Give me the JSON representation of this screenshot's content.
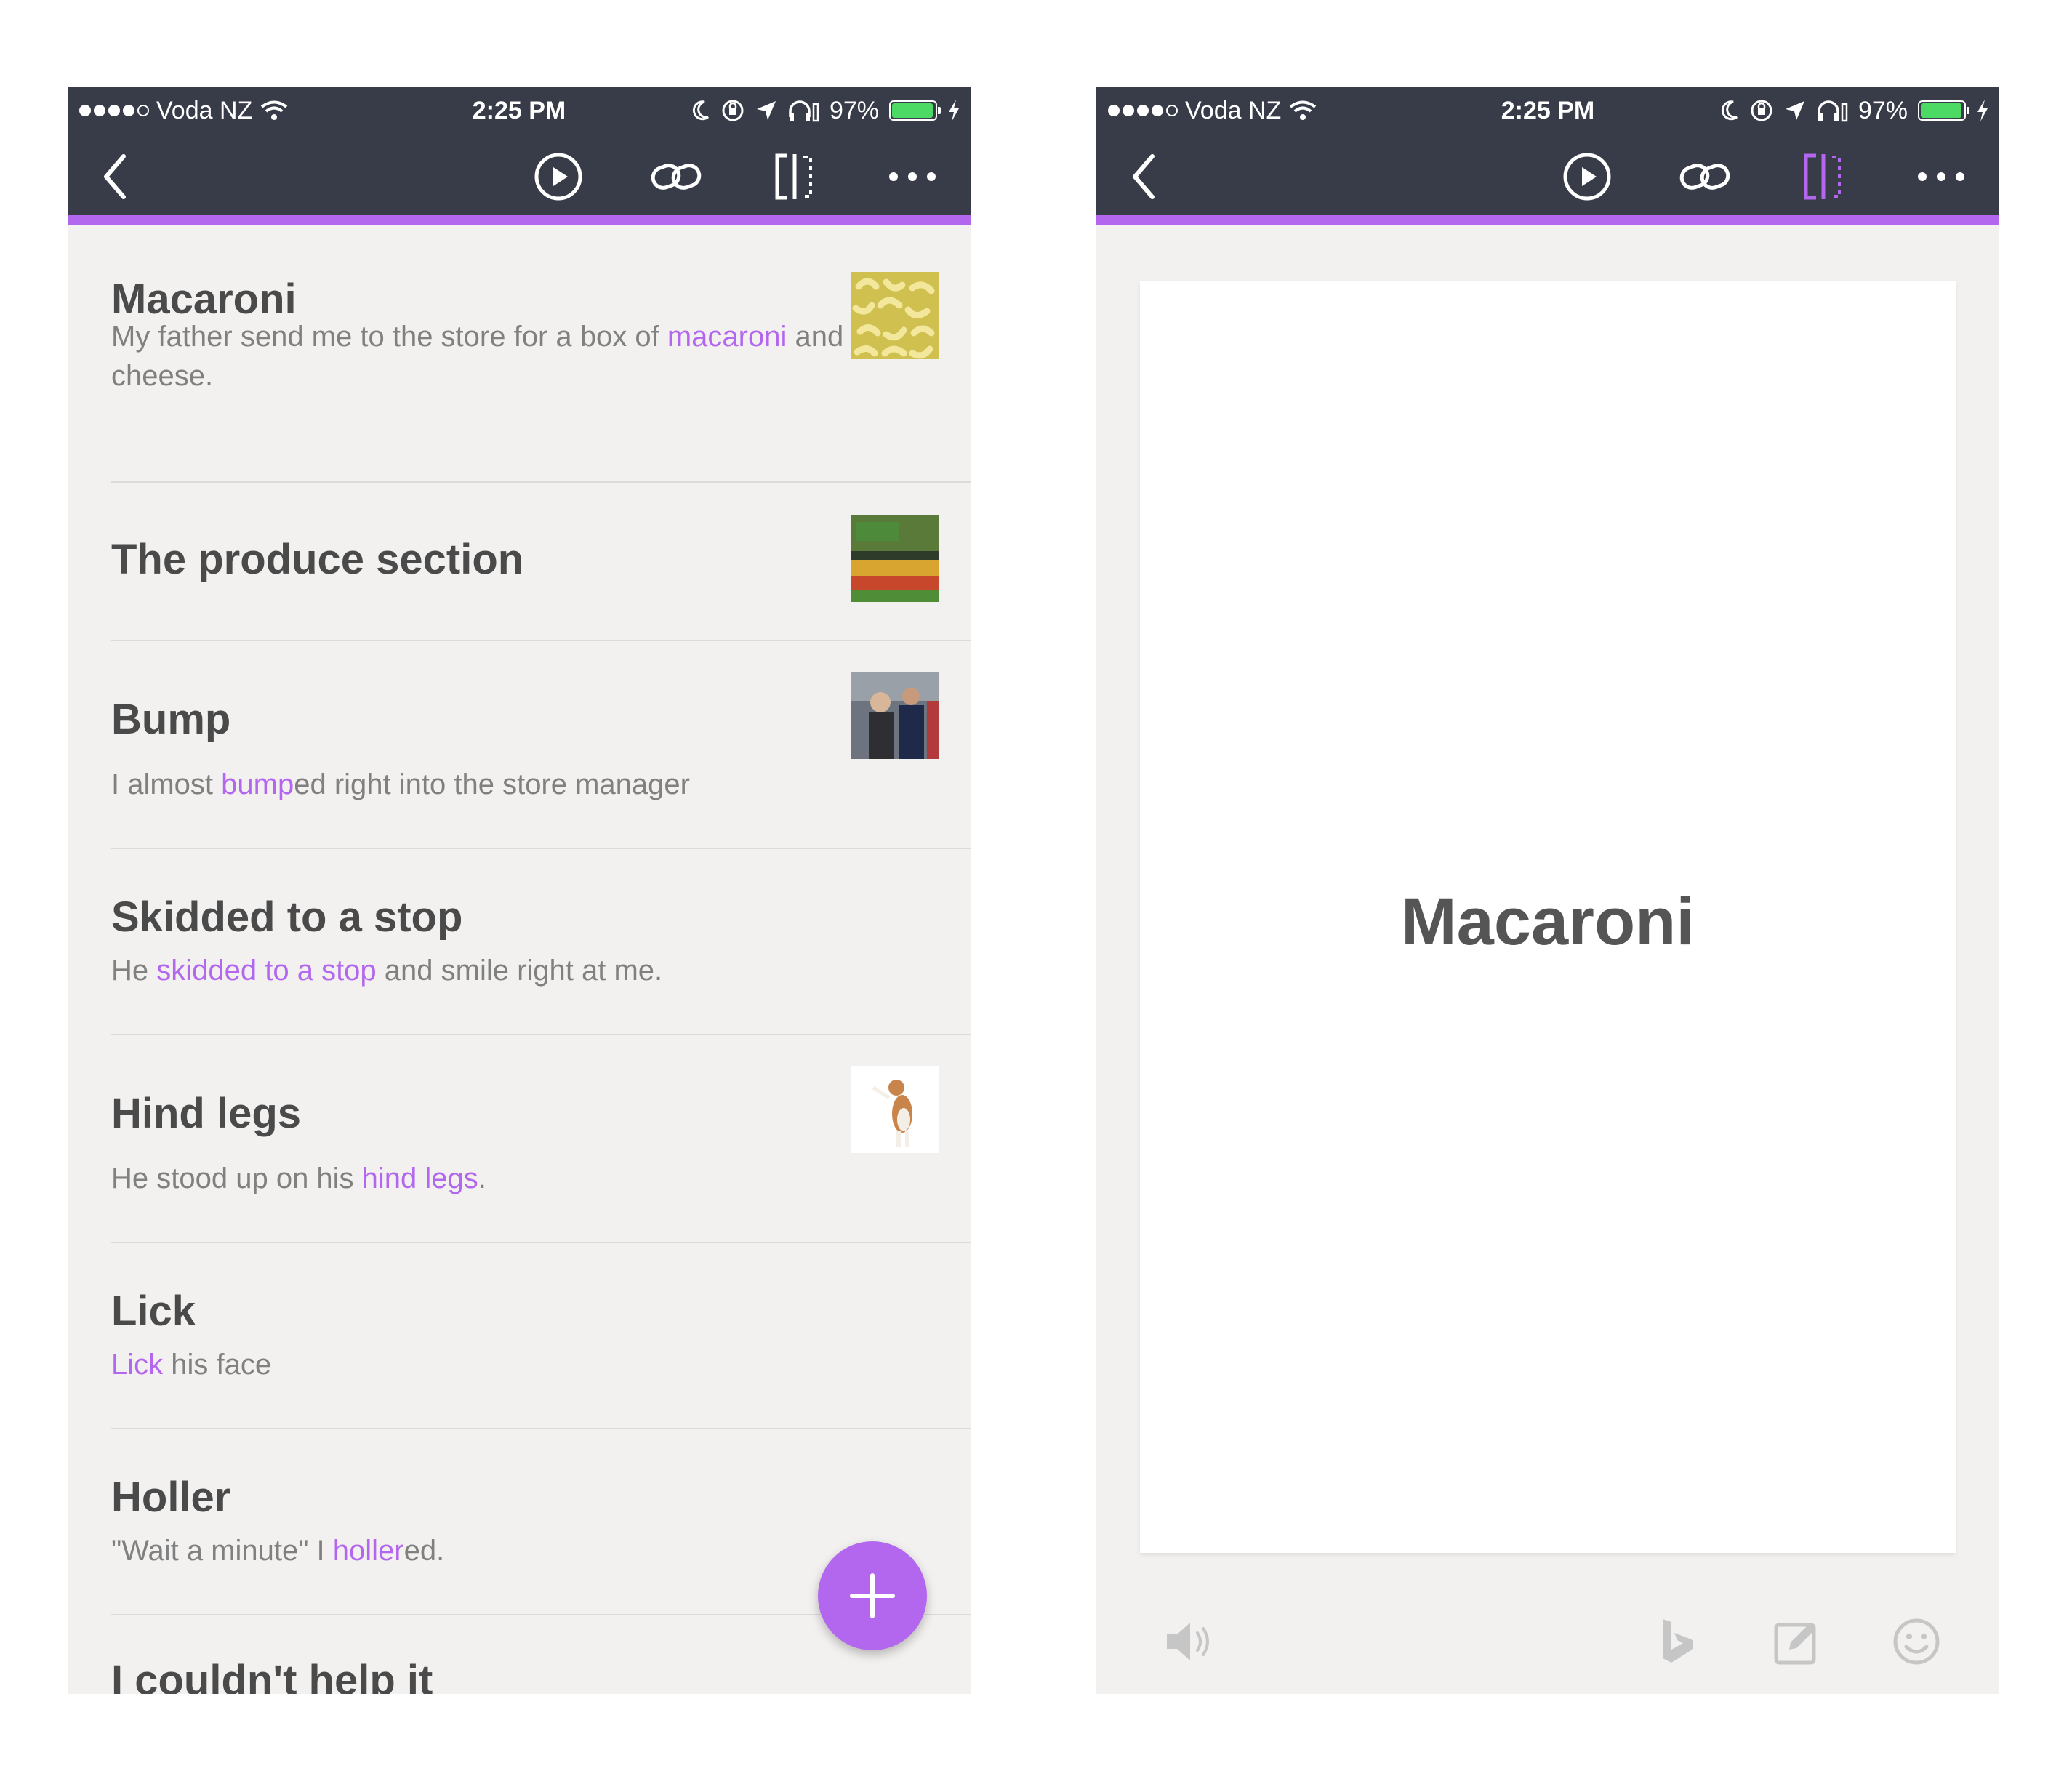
{
  "status_bar": {
    "carrier": "Voda NZ",
    "time": "2:25 PM",
    "battery": "97%",
    "battery_level": 0.97,
    "battery_color": "#4cd964"
  },
  "toolbar": {
    "icons": [
      "back-chevron-icon",
      "play-icon",
      "link-icon",
      "split-view-icon",
      "more-icon"
    ],
    "active_color": "#b366ee"
  },
  "colors": {
    "accent": "#b366ee",
    "bar": "#383c48"
  },
  "list_items": [
    {
      "title": "Macaroni",
      "sub": [
        {
          "t": "My father send me to the store for a box of "
        },
        {
          "t": "macaroni",
          "hl": true
        },
        {
          "t": " and cheese."
        }
      ],
      "thumb": "macaroni-image"
    },
    {
      "title": "The produce section",
      "sub": [],
      "thumb": "produce-image"
    },
    {
      "title": "Bump",
      "sub": [
        {
          "t": "I almost "
        },
        {
          "t": "bump",
          "hl": true
        },
        {
          "t": "ed right into the store manager"
        }
      ],
      "thumb": "bump-image"
    },
    {
      "title": "Skidded to a stop",
      "sub": [
        {
          "t": "He "
        },
        {
          "t": "skidded to a stop",
          "hl": true
        },
        {
          "t": " and smile right at me."
        }
      ]
    },
    {
      "title": "Hind legs",
      "sub": [
        {
          "t": "He stood up on his "
        },
        {
          "t": "hind legs",
          "hl": true
        },
        {
          "t": "."
        }
      ],
      "thumb": "dog-image"
    },
    {
      "title": "Lick",
      "sub": [
        {
          "t": "Lick",
          "hl": true
        },
        {
          "t": " his face"
        }
      ]
    },
    {
      "title": "Holler",
      "sub": [
        {
          "t": "\"Wait a minute\" I "
        },
        {
          "t": "holler",
          "hl": true
        },
        {
          "t": "ed."
        }
      ]
    },
    {
      "title": "I couldn't help it",
      "sub": []
    }
  ],
  "card": {
    "title": "Macaroni"
  },
  "bottom_bar": {
    "icons": [
      "speaker-icon",
      "bing-icon",
      "edit-icon",
      "smiley-icon"
    ]
  }
}
